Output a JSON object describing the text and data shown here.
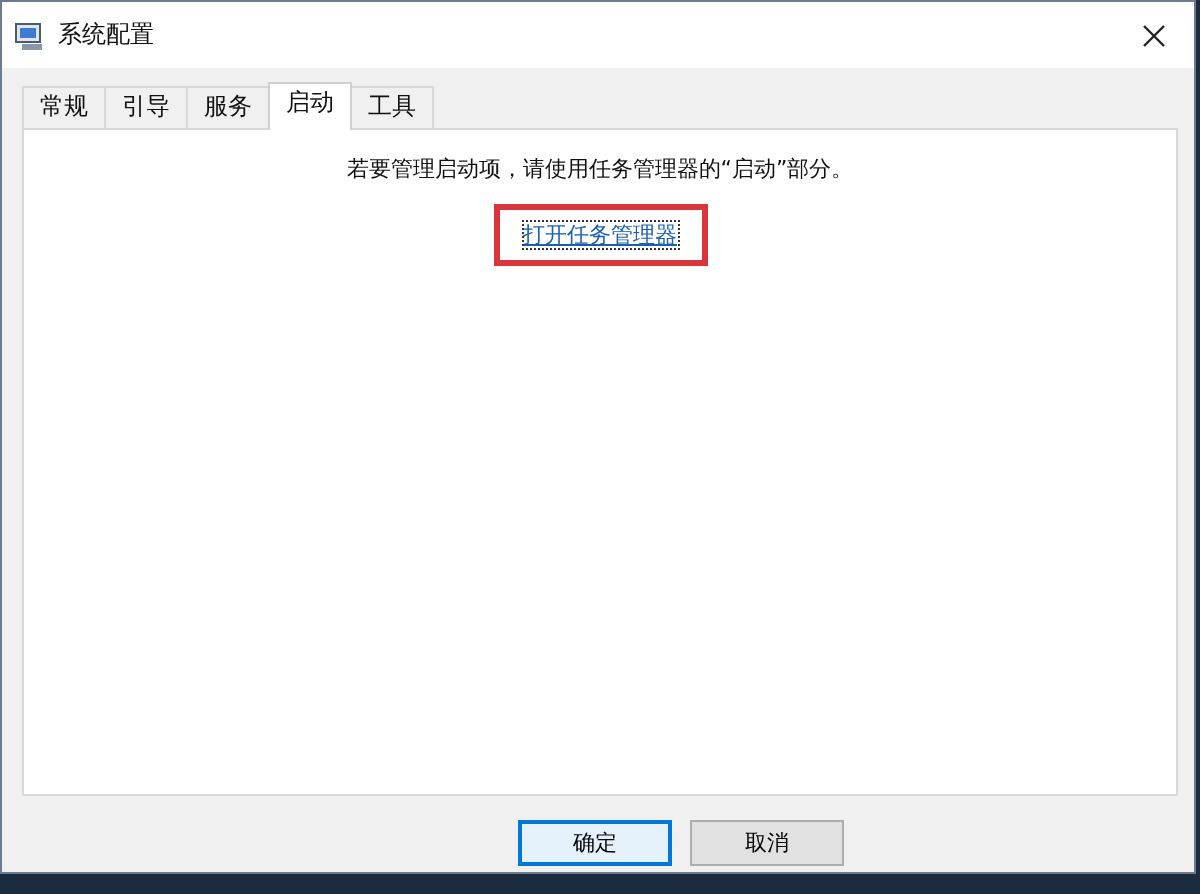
{
  "window": {
    "title": "系统配置"
  },
  "tabs": [
    {
      "label": "常规",
      "selected": false
    },
    {
      "label": "引导",
      "selected": false
    },
    {
      "label": "服务",
      "selected": false
    },
    {
      "label": "启动",
      "selected": true
    },
    {
      "label": "工具",
      "selected": false
    }
  ],
  "message": "若要管理启动项，请使用任务管理器的“启动”部分。",
  "link": {
    "label": "打开任务管理器",
    "highlighted": true
  },
  "buttons": [
    {
      "label": "确定",
      "default": true
    },
    {
      "label": "取消",
      "default": false
    }
  ]
}
